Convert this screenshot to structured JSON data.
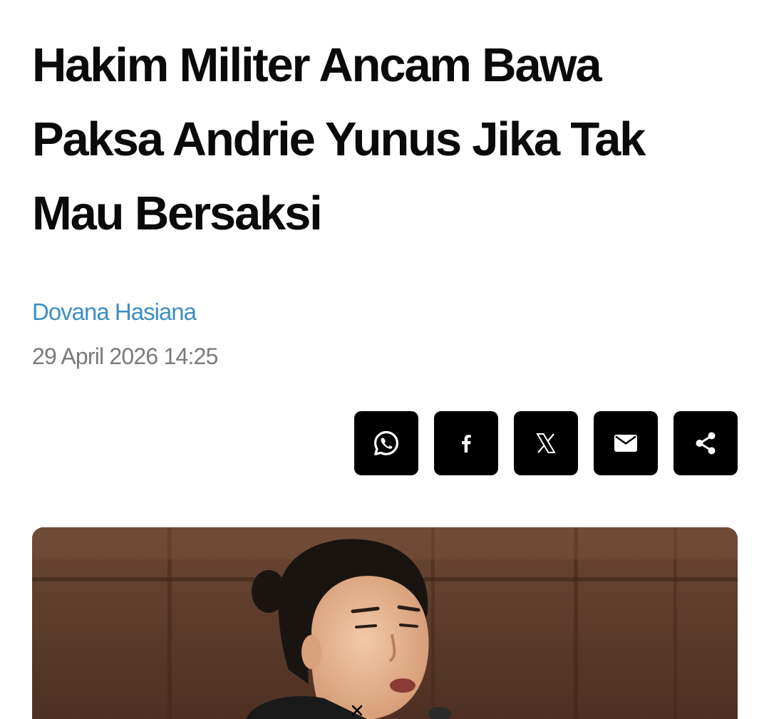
{
  "article": {
    "headline": "Hakim Militer Ancam Bawa Paksa Andrie Yunus Jika Tak Mau Bersaksi",
    "author": "Dovana Hasiana",
    "date": "29 April 2026 14:25"
  },
  "share": {
    "buttons": [
      {
        "icon": "whatsapp-icon"
      },
      {
        "icon": "facebook-icon"
      },
      {
        "icon": "x-icon"
      },
      {
        "icon": "mail-icon"
      },
      {
        "icon": "share-icon"
      }
    ]
  },
  "colors": {
    "author_link": "#3d8ec4",
    "date_text": "#7a7a7a",
    "share_button_bg": "#000000",
    "headline_text": "#0a0a0a"
  },
  "overlay": {
    "close_icon": "close-icon"
  }
}
